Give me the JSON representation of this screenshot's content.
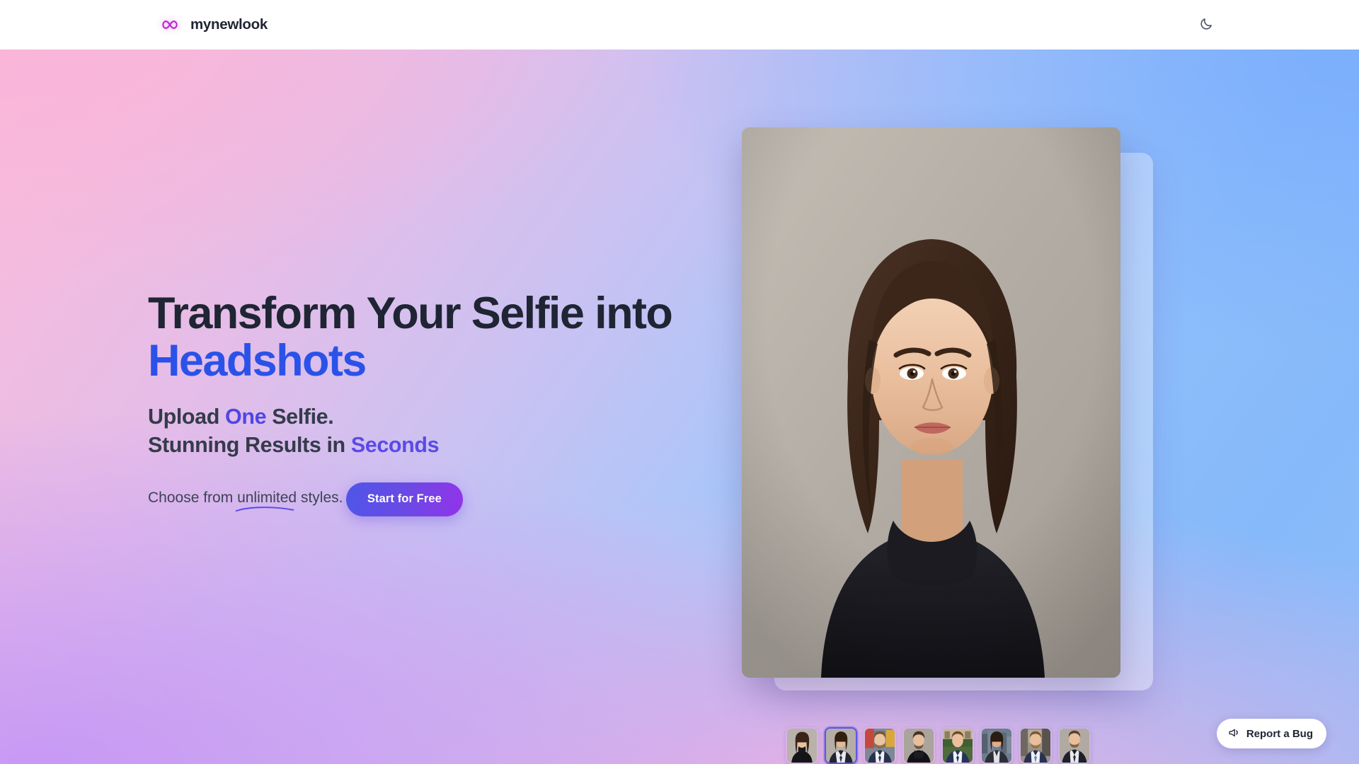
{
  "header": {
    "brand_name": "mynewlook",
    "logo_icon": "infinity-icon",
    "logo_color": "#c026d3",
    "theme_toggle_icon": "moon-icon",
    "theme_toggle_label": "Toggle dark mode"
  },
  "hero": {
    "headline_line1": "Transform Your Selfie into",
    "headline_line2": "Headshots",
    "subhead_line1_a": "Upload ",
    "subhead_line1_b": "One",
    "subhead_line1_c": " Selfie.",
    "subhead_line2_a": "Stunning Results in ",
    "subhead_line2_b": "Seconds",
    "tagline_a": "Choose from ",
    "tagline_b": "unlimited",
    "tagline_c": " styles.",
    "cta_label": "Start for Free",
    "colors": {
      "headline_dark": "#1f2533",
      "headline_blue": "#2b52e8",
      "accent_indigo": "#4f46e5",
      "cta_gradient_from": "#4f56e8",
      "cta_gradient_to": "#9333ea",
      "underline": "#5b4ae8"
    }
  },
  "showcase": {
    "main_photo_alt": "Headshot of a woman in a black turtleneck on a warm gray studio background",
    "thumbnails": [
      {
        "alt": "Woman in black turtleneck, gray background",
        "selected": false
      },
      {
        "alt": "Woman in dark business suit, gray background",
        "selected": true
      },
      {
        "alt": "Man in navy suit, city street background",
        "selected": false
      },
      {
        "alt": "Man in black turtleneck, gray background",
        "selected": false
      },
      {
        "alt": "Man in navy suit, green garden background",
        "selected": false
      },
      {
        "alt": "Woman in dark blazer, city skyline background",
        "selected": false
      },
      {
        "alt": "Man in navy suit, modern building background",
        "selected": false
      },
      {
        "alt": "Man in dark suit and tie, gray background",
        "selected": false
      }
    ]
  },
  "footer_widget": {
    "report_bug_label": "Report a Bug",
    "report_bug_icon": "megaphone-icon"
  }
}
